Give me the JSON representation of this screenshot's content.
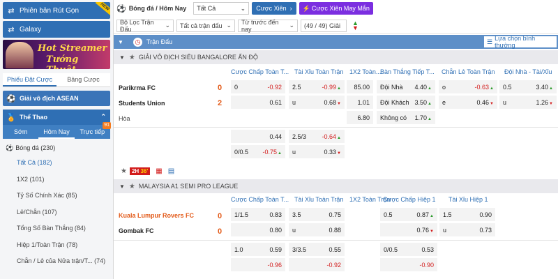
{
  "sidebar": {
    "quick_version": "Phiên bản Rút Gọn",
    "new_badge": "NEW",
    "galaxy": "Galaxy",
    "banner": {
      "line1": "Hot Streamer",
      "line2": "Tướng Thuật"
    },
    "tabs": [
      {
        "label": "Phiếu Đặt Cược",
        "active": true
      },
      {
        "label": "Bảng Cược",
        "active": false
      }
    ],
    "asean": "Giải vô địch ASEAN",
    "sports_title": "Thể Thao",
    "time_tabs": [
      {
        "label": "Sớm",
        "active": false
      },
      {
        "label": "Hôm Nay",
        "active": true
      },
      {
        "label": "Trực tiếp",
        "active": false,
        "badge": "91"
      }
    ],
    "sport": {
      "label": "Bóng đá",
      "count": "(230)"
    },
    "bet_types": [
      {
        "label": "Tất Cả",
        "count": "(182)",
        "active": true
      },
      {
        "label": "1X2",
        "count": "(101)",
        "active": false
      },
      {
        "label": "Tỷ Số Chính Xác",
        "count": "(85)",
        "active": false
      },
      {
        "label": "Lẻ/Chẵn",
        "count": "(107)",
        "active": false
      },
      {
        "label": "Tổng Số Bàn Thắng",
        "count": "(84)",
        "active": false
      },
      {
        "label": "Hiệp 1/Toàn Trận",
        "count": "(78)",
        "active": false
      },
      {
        "label": "Chẵn / Lẻ của Nửa trận/T...",
        "count": "(74)",
        "active": false
      }
    ]
  },
  "topbar": {
    "breadcrumb": "Bóng đá / Hôm Nay",
    "filter_all": "Tất Cả",
    "parlay_button": "Cược Xiên",
    "lucky_button": "Cược Xiên May Mắn"
  },
  "filterbar": {
    "league_filter": "Bộ Lọc Trận Đấu",
    "match_filter": "Tất cả trận đấu",
    "sort_filter": "Từ trước đến nay",
    "count": "(49 / 49) Giải"
  },
  "main_header": {
    "title": "Trận Đấu",
    "view_select": "Lựa chọn bình thường"
  },
  "leagues": [
    {
      "name": "GIẢI VÔ ĐỊCH SIÊU BANGALORE ẤN ĐỘ",
      "columns": [
        "Cược Chấp Toàn T...",
        "Tài Xỉu Toàn Trận",
        "1X2 Toàn...",
        "Bàn Thắng Tiếp T...",
        "Chẵn Lẻ Toàn Trận",
        "Đội Nhà - Tài/Xỉu"
      ],
      "home": {
        "name": "Parikrma FC",
        "score": "0"
      },
      "away": {
        "name": "Students Union",
        "score": "2"
      },
      "draw": "Hòa",
      "handicap": {
        "line": "0",
        "home": "-0.92",
        "away": "0.61"
      },
      "total": {
        "line": "2.5",
        "over": "-0.99",
        "under_label": "u",
        "under": "0.68"
      },
      "x12": {
        "home": "85.00",
        "away": "1.01",
        "draw": "6.80"
      },
      "next_goal": [
        {
          "label": "Đội Nhà",
          "odd": "4.40"
        },
        {
          "label": "Đội Khách",
          "odd": "3.50"
        },
        {
          "label": "Không có",
          "odd": "1.70"
        }
      ],
      "odd_even": {
        "odd_label": "o",
        "odd": "-0.63",
        "even_label": "e",
        "even": "0.46"
      },
      "home_ou": {
        "line": "0.5",
        "over": "3.40",
        "under_label": "u",
        "under": "1.26"
      },
      "alt_handicap": {
        "home": "0.44",
        "line": "0/0.5",
        "away": "-0.75"
      },
      "alt_total": {
        "line": "2.5/3",
        "over": "-0.64",
        "under_label": "u",
        "under": "0.33"
      },
      "live": {
        "half": "2H",
        "minute": "36'"
      }
    },
    {
      "name": "MALAYSIA A1 SEMI PRO LEAGUE",
      "columns": [
        "Cược Chấp Toàn T...",
        "Tài Xỉu Toàn Trận",
        "1X2 Toàn Trận",
        "Cược Chấp Hiệp 1",
        "Tài Xỉu Hiệp 1"
      ],
      "home": {
        "name": "Kuala Lumpur Rovers FC",
        "score": "0"
      },
      "away": {
        "name": "Gombak FC",
        "score": "0"
      },
      "handicap": {
        "line": "1/1.5",
        "home": "0.83",
        "away": "0.80"
      },
      "total": {
        "line": "3.5",
        "over": "0.75",
        "under_label": "u",
        "under": "0.88"
      },
      "h1_handicap": {
        "line": "0.5",
        "home": "0.87",
        "away": "0.76"
      },
      "h1_total": {
        "line": "1.5",
        "over": "0.90",
        "under_label": "u",
        "under": "0.73"
      },
      "alt_handicap": {
        "line": "1.0",
        "home": "0.59",
        "away": "-0.96"
      },
      "alt_total": {
        "line": "3/3.5",
        "over": "0.55",
        "under": "-0.92"
      },
      "alt_h1_handicap": {
        "line": "0/0.5",
        "home": "0.53",
        "away": "-0.90"
      }
    }
  ],
  "colors": {
    "primary": "#2f6fb4",
    "purple": "#7b2ee0",
    "negative": "#d21b1b",
    "score": "#e35b1a",
    "positive": "#2a9a2a"
  }
}
